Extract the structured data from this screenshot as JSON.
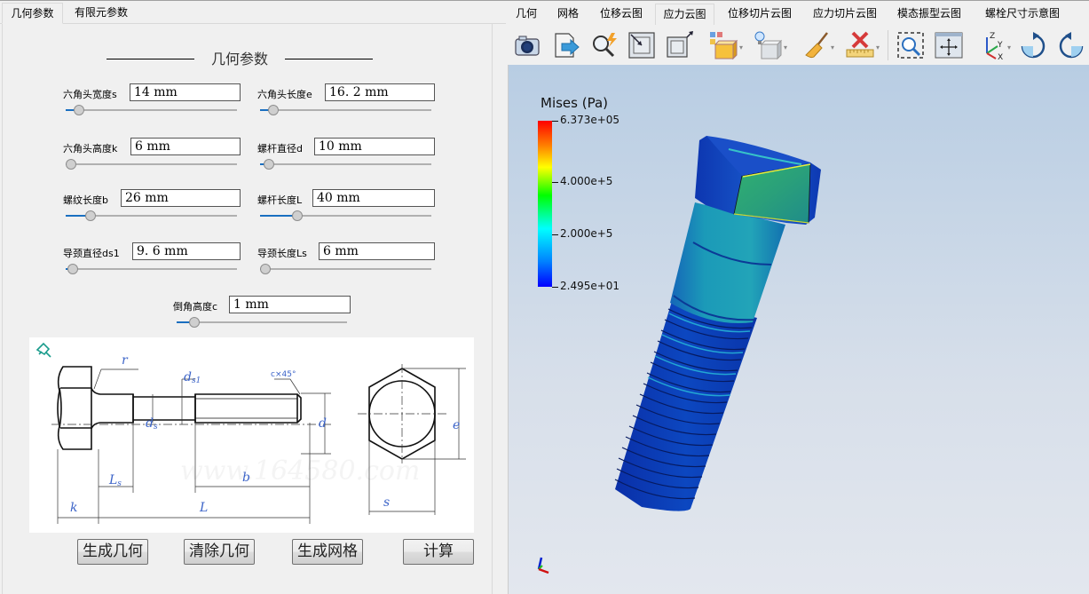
{
  "left_tabs": [
    {
      "label": "几何参数",
      "active": true
    },
    {
      "label": "有限元参数",
      "active": false
    }
  ],
  "section_title": "几何参数",
  "params": [
    {
      "label": "六角头宽度s",
      "value": "14  mm",
      "slider_fraction": 0.05
    },
    {
      "label": "六角头长度e",
      "value": "16. 2  mm",
      "slider_fraction": 0.05
    },
    {
      "label": "六角头高度k",
      "value": "6  mm",
      "slider_fraction": 0.0
    },
    {
      "label": "螺杆直径d",
      "value": "10  mm",
      "slider_fraction": 0.02
    },
    {
      "label": "螺纹长度b",
      "value": "26  mm",
      "slider_fraction": 0.12
    },
    {
      "label": "螺杆长度L",
      "value": "40  mm",
      "slider_fraction": 0.2
    },
    {
      "label": "导颈直径ds1",
      "value": "9. 6  mm",
      "slider_fraction": 0.01
    },
    {
      "label": "导颈长度Ls",
      "value": "6  mm",
      "slider_fraction": 0.0
    },
    {
      "label": "倒角高度c",
      "value": "1  mm",
      "slider_fraction": 0.08
    }
  ],
  "diagram": {
    "labels": {
      "r": "r",
      "ds1": "d",
      "ds1_sub": "s1",
      "ds": "d",
      "ds_sub": "s",
      "chamfer": "c×45°",
      "d": "d",
      "e": "e",
      "Ls": "L",
      "Ls_sub": "s",
      "b": "b",
      "k": "k",
      "L": "L",
      "s": "s"
    },
    "watermark": "www.164580.com"
  },
  "buttons": {
    "gen_geometry": "生成几何",
    "clear_geometry": "清除几何",
    "gen_mesh": "生成网格",
    "compute": "计算"
  },
  "right_tabs": [
    {
      "label": "几何",
      "active": false
    },
    {
      "label": "网格",
      "active": false
    },
    {
      "label": "位移云图",
      "active": false
    },
    {
      "label": "应力云图",
      "active": true
    },
    {
      "label": "位移切片云图",
      "active": false
    },
    {
      "label": "应力切片云图",
      "active": false
    },
    {
      "label": "模态振型云图",
      "active": false
    },
    {
      "label": "螺栓尺寸示意图",
      "active": false
    }
  ],
  "toolbar": [
    "camera-icon",
    "export-icon",
    "quick-find-icon",
    "zoom-in-box-icon",
    "zoom-out-box-icon",
    "representation-icon",
    "lighting-icon",
    "clear-icon",
    "measure-icon",
    "zoom-region-icon",
    "fit-view-icon",
    "axes-icon",
    "rotate-cw-icon",
    "rotate-ccw-icon"
  ],
  "legend": {
    "title": "Mises (Pa)",
    "max": "6.373e+05",
    "mid_high": "4.000e+5",
    "mid_low": "2.000e+5",
    "min": "2.495e+01",
    "max_value": 637300,
    "min_value": 24.95,
    "colors": {
      "low": "#0000ff",
      "mid": "#00ffff",
      "midhigh": "#00ff00",
      "high": "#ff0000"
    }
  },
  "axes": {
    "x": "X",
    "y": "Y",
    "z": "Z"
  }
}
